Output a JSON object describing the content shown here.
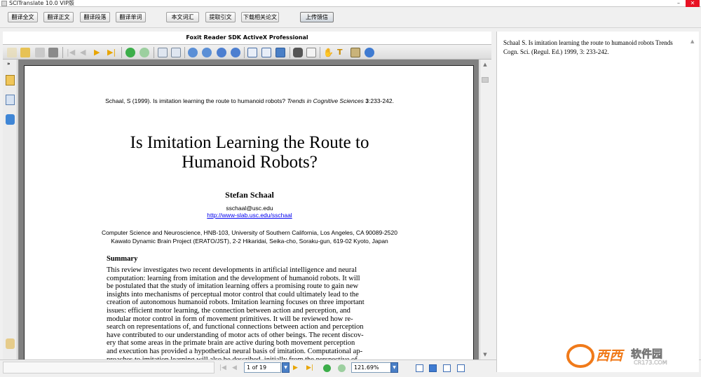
{
  "window": {
    "title": "SCITranslate 10.0 VIP版"
  },
  "toolbar": {
    "buttons": [
      "翻译全文",
      "翻译正文",
      "翻译段落",
      "翻译单词",
      "本文词汇",
      "提取引文",
      "下载相关论文",
      "上传馈信"
    ]
  },
  "viewer": {
    "title": "Foxit Reader SDK ActiveX Professional",
    "page_field": "1 of 19",
    "zoom_field": "121.69%"
  },
  "document": {
    "citation_plain": "Schaal, S (1999). Is imitation learning the route to humanoid robots? ",
    "citation_journal": "Trends in Cognitive Sciences",
    "citation_vol": " 3",
    "citation_pages": ":233-242.",
    "title_line1": "Is Imitation Learning the Route to",
    "title_line2": "Humanoid Robots?",
    "author": "Stefan Schaal",
    "email": "sschaal@usc.edu",
    "url": "http://www-slab.usc.edu/sschaal",
    "affiliation1": "Computer Science and Neuroscience, HNB-103, University of Southern California, Los Angeles, CA 90089-2520",
    "affiliation2": "Kawato Dynamic Brain Project (ERATO/JST), 2-2 Hikaridai, Seika-cho, Soraku-gun, 619-02 Kyoto, Japan",
    "summary_heading": "Summary",
    "summary_lines": [
      "This review investigates two recent developments in artificial intelligence and neural",
      "computation: learning from imitation and the development of humanoid robots. It will",
      "be postulated that the study of imitation learning offers a promising route to gain new",
      "insights into mechanisms of perceptual motor control that could ultimately lead to the",
      "creation of autonomous humanoid robots. Imitation learning focuses on three important",
      "issues: efficient motor learning, the connection between action and perception, and",
      "modular motor control in form of movement primitives. It will be reviewed how re-",
      "search on representations of, and functional connections between action and perception",
      "have contributed to our understanding of motor acts of other beings. The recent discov-",
      "ery that some areas in the primate brain are active during both movement perception",
      "and execution has provided a hypothetical neural basis of imitation. Computational ap-",
      "proaches to imitation learning will also be described, initially from the perspective of"
    ]
  },
  "right_panel": {
    "text": "Schaal S. Is imitation learning the route to humanoid robots Trends Cogn. Sci. (Regul. Ed.) 1999, 3: 233-242."
  },
  "watermark": {
    "logo_text": "西西",
    "brand": "软件园",
    "site": "CR173.COM"
  },
  "colors": {
    "accent_blue": "#2f6fc4",
    "link_blue": "#0000ee",
    "logo_orange": "#f07a1a"
  }
}
